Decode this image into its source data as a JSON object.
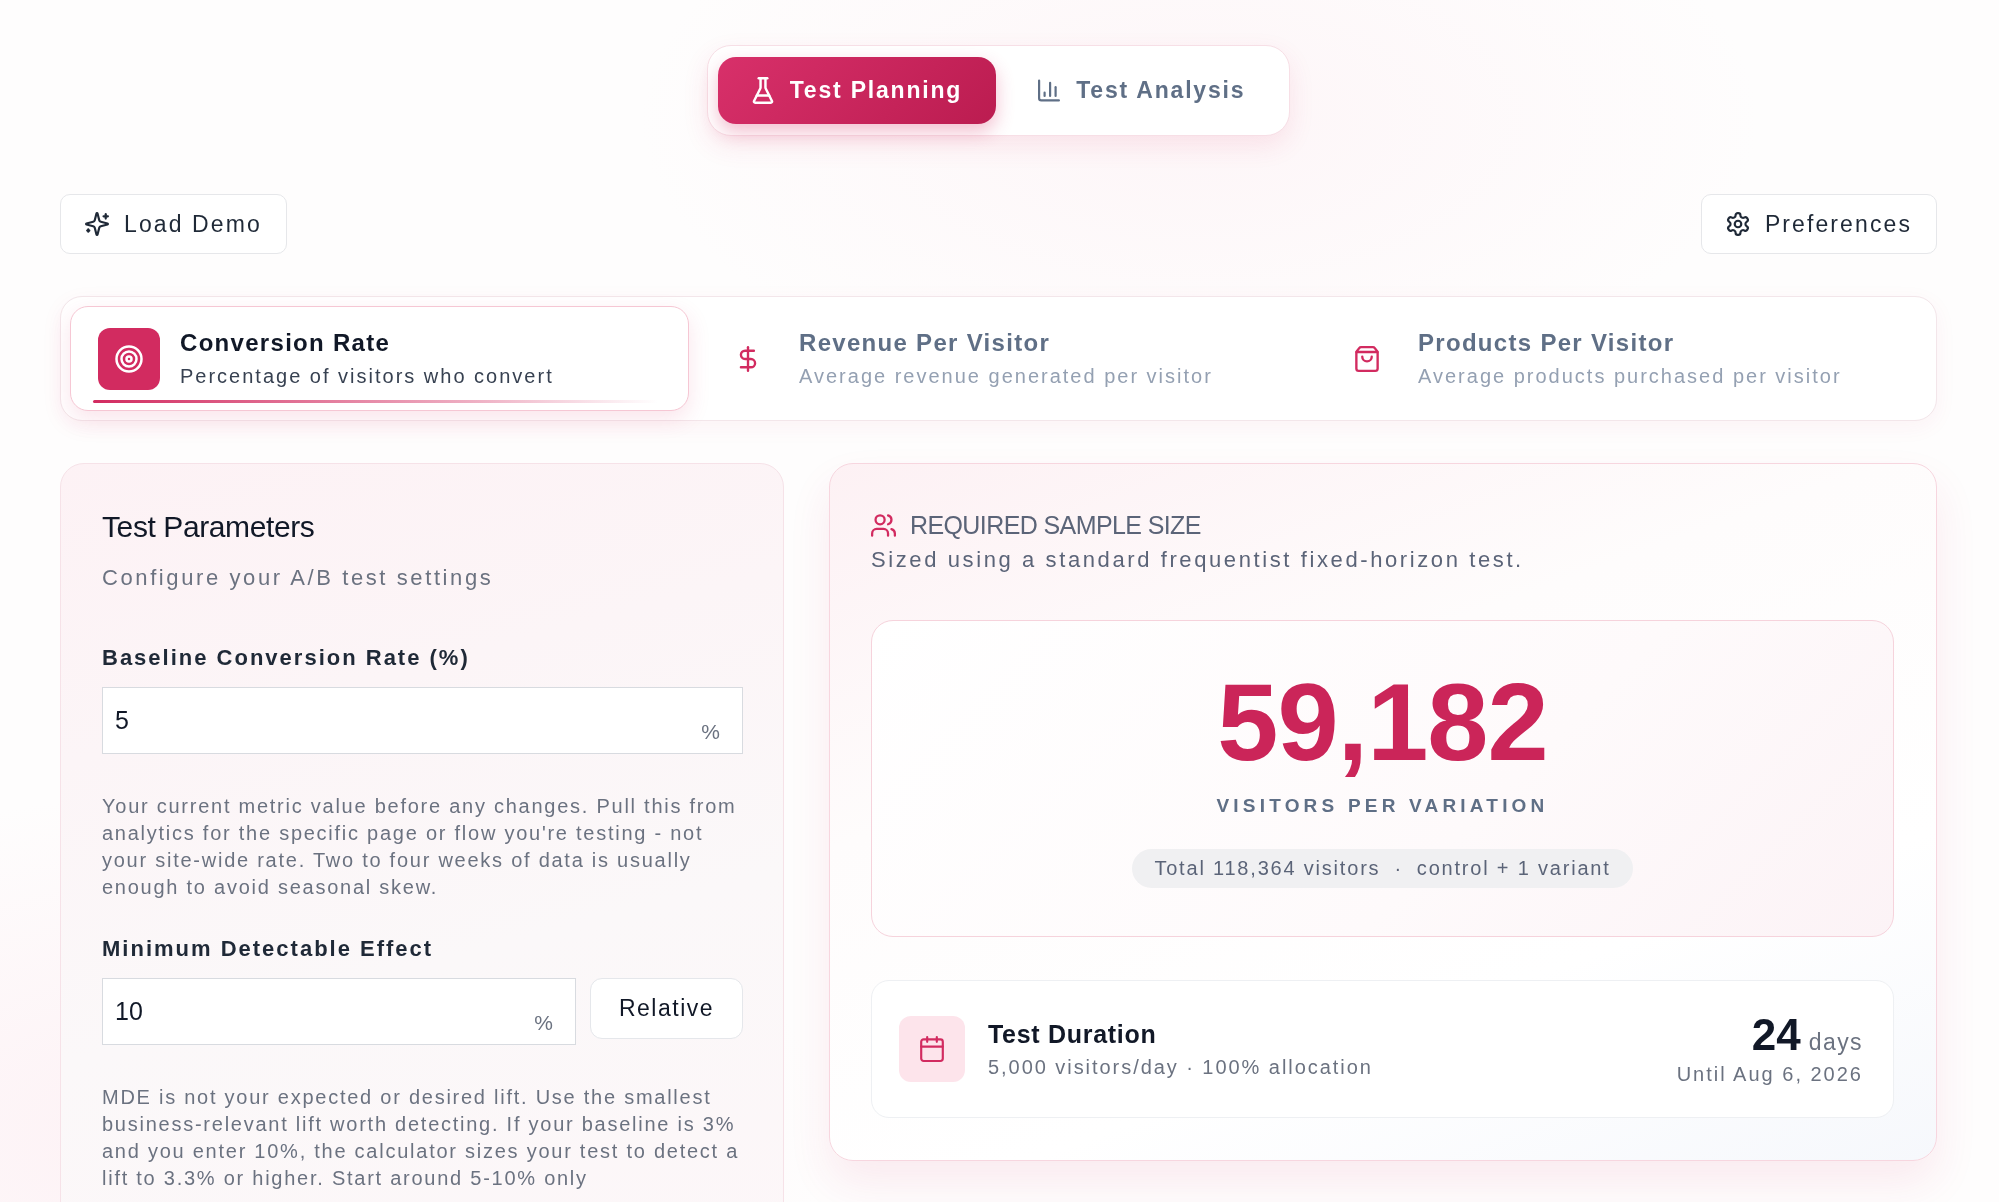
{
  "mode_tabs": [
    {
      "label": "Test Planning",
      "selected": true
    },
    {
      "label": "Test Analysis",
      "selected": false
    }
  ],
  "toolbar": {
    "load_demo": "Load Demo",
    "preferences": "Preferences"
  },
  "metric_tabs": [
    {
      "title": "Conversion Rate",
      "description": "Percentage of visitors who convert",
      "selected": true
    },
    {
      "title": "Revenue Per Visitor",
      "description": "Average revenue generated per visitor",
      "selected": false
    },
    {
      "title": "Products Per Visitor",
      "description": "Average products purchased per visitor",
      "selected": false
    }
  ],
  "test_parameters": {
    "title": "Test Parameters",
    "subtitle": "Configure your A/B test settings",
    "fields": [
      {
        "label": "Baseline Conversion Rate (%)",
        "value": "5",
        "unit": "%",
        "help": "Your current metric value before any changes. Pull this from analytics for the specific page or flow you're testing - not your site-wide rate. Two to four weeks of data is usually enough to avoid seasonal skew."
      },
      {
        "label": "Minimum Detectable Effect",
        "value": "10",
        "unit": "%",
        "mode": "Relative",
        "help": "MDE is not your expected or desired lift. Use the smallest business-relevant lift worth detecting. If your baseline is 3% and you enter 10%, the calculator sizes your test to detect a lift to 3.3% or higher. Start around 5-10% only"
      }
    ]
  },
  "sample_size": {
    "title": "REQUIRED SAMPLE SIZE",
    "subtitle": "Sized using a standard frequentist fixed-horizon test.",
    "value": "59,182",
    "caption": "VISITORS PER VARIATION",
    "total": "Total 118,364 visitors",
    "separator": "·",
    "design": "control + 1 variant"
  },
  "duration": {
    "title": "Test Duration",
    "detail": "5,000 visitors/day · 100% allocation",
    "value": "24",
    "unit": "days",
    "until": "Until Aug 6, 2026"
  }
}
